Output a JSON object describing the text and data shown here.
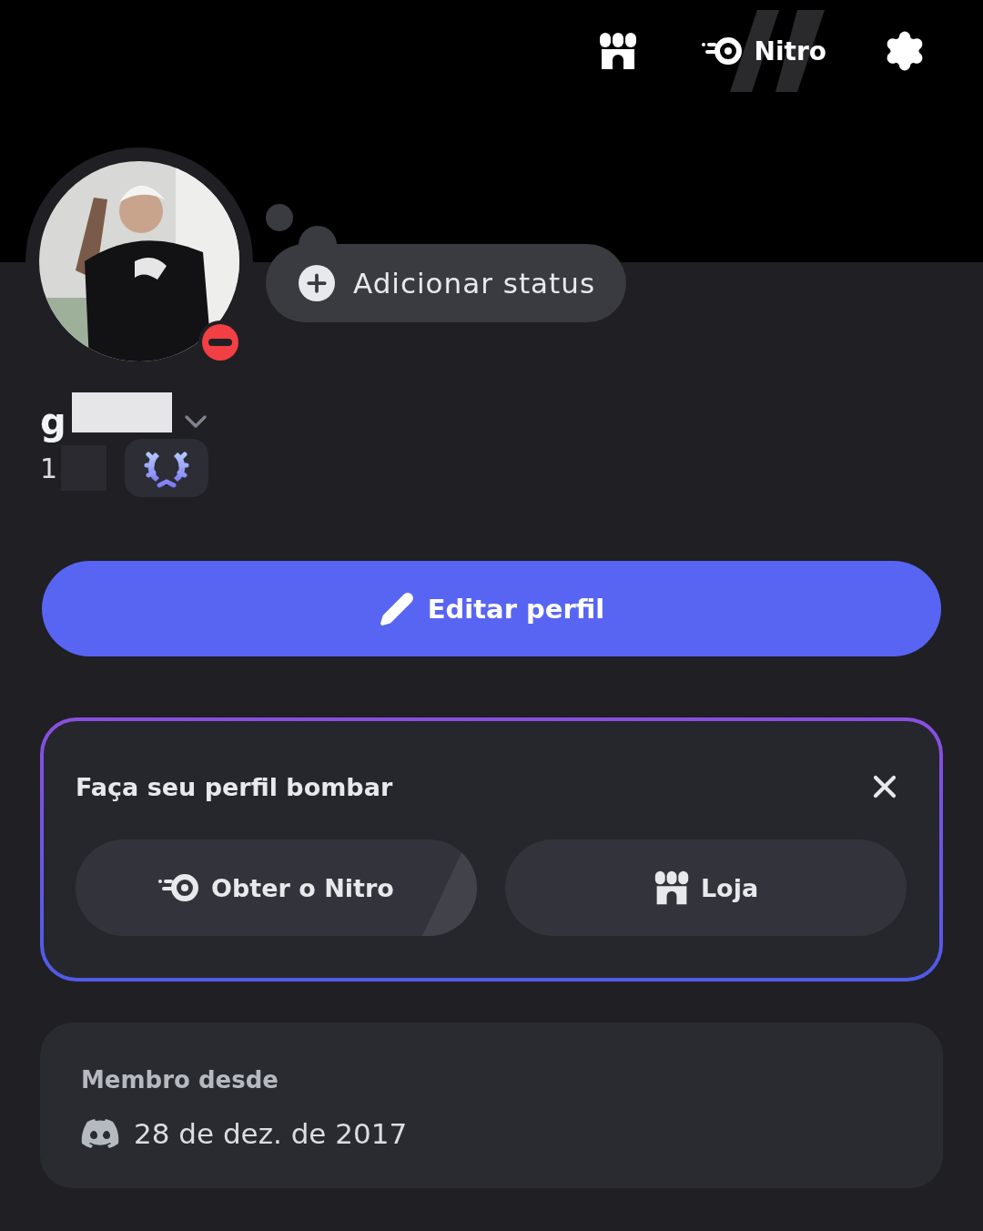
{
  "header": {
    "nitro_label": "Nitro"
  },
  "profile": {
    "status_button": "Adicionar status",
    "do_not_disturb": true,
    "username": "g",
    "tag": "1",
    "redacted": true
  },
  "edit_button": "Editar perfil",
  "promo": {
    "title": "Faça seu perfil bombar",
    "buttons": [
      {
        "kind": "nitro",
        "label": "Obter o Nitro"
      },
      {
        "kind": "shop",
        "label": "Loja"
      }
    ]
  },
  "member": {
    "heading": "Membro desde",
    "date": "28 de dez. de 2017"
  }
}
